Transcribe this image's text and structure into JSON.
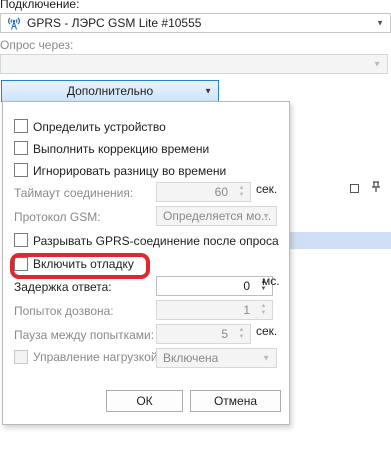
{
  "background": {
    "connection_label": "Подключение:",
    "connection_value": "GPRS - ЛЭРС GSM Lite #10555",
    "poll_via_label": "Опрос через:",
    "poll_via_value": "",
    "expander_label": "Дополнительно",
    "panel_icons": [
      "square-icon",
      "pin-icon"
    ]
  },
  "popup": {
    "detect_device": {
      "label": "Определить устройство",
      "checked": false
    },
    "time_correction": {
      "label": "Выполнить коррекцию времени",
      "checked": false
    },
    "ignore_time_diff": {
      "label": "Игнорировать разницу во времени",
      "checked": false
    },
    "connect_timeout": {
      "label": "Таймаут соединения:",
      "value": "60",
      "unit": "сек."
    },
    "gsm_protocol": {
      "label": "Протокол GSM:",
      "value": "Определяется мо..."
    },
    "drop_gprs": {
      "label": "Разрывать GPRS-соединение после опроса",
      "checked": false
    },
    "enable_debug": {
      "label": "Включить отладку",
      "checked": false
    },
    "response_delay": {
      "label": "Задержка ответа:",
      "value": "0",
      "unit": "мс."
    },
    "dial_attempts": {
      "label": "Попыток дозвона:",
      "value": "1"
    },
    "attempt_pause": {
      "label": "Пауза между попытками:",
      "value": "5",
      "unit": "сек."
    },
    "load_control": {
      "label": "Управление нагрузкой:",
      "value": "Включена"
    },
    "ok_label": "ОК",
    "cancel_label": "Отмена"
  },
  "colors": {
    "annotation": "#e0262f",
    "accent": "#2f7fd0"
  }
}
